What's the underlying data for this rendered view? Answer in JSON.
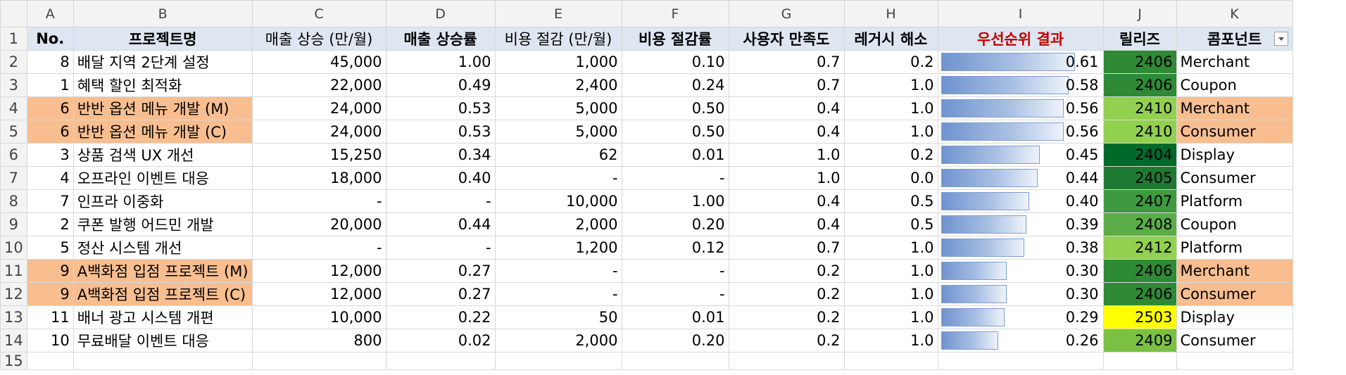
{
  "column_letters": [
    "A",
    "B",
    "C",
    "D",
    "E",
    "F",
    "G",
    "H",
    "I",
    "J",
    "K"
  ],
  "headers": [
    "No.",
    "프로젝트명",
    "매출 상승 (만/월)",
    "매출 상승률",
    "비용 절감 (만/월)",
    "비용 절감률",
    "사용자 만족도",
    "레거시 해소",
    "우선순위 결과",
    "릴리즈",
    "콤포넌트"
  ],
  "rows": [
    {
      "row": "2",
      "no": "8",
      "name": "배달 지역 2단계 설정",
      "rev": "45,000",
      "rev_rate": "1.00",
      "cost": "1,000",
      "cost_rate": "0.10",
      "sat": "0.7",
      "legacy": "0.2",
      "priority": "0.61",
      "priority_value": 0.61,
      "release": "2406",
      "release_color": "#2f8a35",
      "component": "Merchant",
      "highlight": false
    },
    {
      "row": "3",
      "no": "1",
      "name": "혜택 할인 최적화",
      "rev": "22,000",
      "rev_rate": "0.49",
      "cost": "2,400",
      "cost_rate": "0.24",
      "sat": "0.7",
      "legacy": "1.0",
      "priority": "0.58",
      "priority_value": 0.58,
      "release": "2406",
      "release_color": "#2f8a35",
      "component": "Coupon",
      "highlight": false
    },
    {
      "row": "4",
      "no": "6",
      "name": "반반 옵션 메뉴 개발 (M)",
      "rev": "24,000",
      "rev_rate": "0.53",
      "cost": "5,000",
      "cost_rate": "0.50",
      "sat": "0.4",
      "legacy": "1.0",
      "priority": "0.56",
      "priority_value": 0.56,
      "release": "2410",
      "release_color": "#92d050",
      "component": "Merchant",
      "highlight": true
    },
    {
      "row": "5",
      "no": "6",
      "name": "반반 옵션 메뉴 개발 (C)",
      "rev": "24,000",
      "rev_rate": "0.53",
      "cost": "5,000",
      "cost_rate": "0.50",
      "sat": "0.4",
      "legacy": "1.0",
      "priority": "0.56",
      "priority_value": 0.56,
      "release": "2410",
      "release_color": "#92d050",
      "component": "Consumer",
      "highlight": true
    },
    {
      "row": "6",
      "no": "3",
      "name": "상품 검색 UX 개선",
      "rev": "15,250",
      "rev_rate": "0.34",
      "cost": "62",
      "cost_rate": "0.01",
      "sat": "1.0",
      "legacy": "0.2",
      "priority": "0.45",
      "priority_value": 0.45,
      "release": "2404",
      "release_color": "#006a2a",
      "component": "Display",
      "highlight": false
    },
    {
      "row": "7",
      "no": "4",
      "name": "오프라인 이벤트 대응",
      "rev": "18,000",
      "rev_rate": "0.40",
      "cost": "-",
      "cost_rate": "-",
      "sat": "1.0",
      "legacy": "0.0",
      "priority": "0.44",
      "priority_value": 0.44,
      "release": "2405",
      "release_color": "#1e7a33",
      "component": "Consumer",
      "highlight": false
    },
    {
      "row": "8",
      "no": "7",
      "name": "인프라 이중화",
      "rev": "-",
      "rev_rate": "-",
      "cost": "10,000",
      "cost_rate": "1.00",
      "sat": "0.4",
      "legacy": "0.5",
      "priority": "0.40",
      "priority_value": 0.4,
      "release": "2407",
      "release_color": "#3d9a3f",
      "component": "Platform",
      "highlight": false
    },
    {
      "row": "9",
      "no": "2",
      "name": "쿠폰 발행 어드민 개발",
      "rev": "20,000",
      "rev_rate": "0.44",
      "cost": "2,000",
      "cost_rate": "0.20",
      "sat": "0.4",
      "legacy": "0.5",
      "priority": "0.39",
      "priority_value": 0.39,
      "release": "2408",
      "release_color": "#5aad47",
      "component": "Coupon",
      "highlight": false
    },
    {
      "row": "10",
      "no": "5",
      "name": "정산 시스템 개선",
      "rev": "-",
      "rev_rate": "-",
      "cost": "1,200",
      "cost_rate": "0.12",
      "sat": "0.7",
      "legacy": "1.0",
      "priority": "0.38",
      "priority_value": 0.38,
      "release": "2412",
      "release_color": "#92d050",
      "component": "Platform",
      "highlight": false
    },
    {
      "row": "11",
      "no": "9",
      "name": "A백화점 입점 프로젝트 (M)",
      "rev": "12,000",
      "rev_rate": "0.27",
      "cost": "-",
      "cost_rate": "-",
      "sat": "0.2",
      "legacy": "1.0",
      "priority": "0.30",
      "priority_value": 0.3,
      "release": "2406",
      "release_color": "#2f8a35",
      "component": "Merchant",
      "highlight": true
    },
    {
      "row": "12",
      "no": "9",
      "name": "A백화점 입점 프로젝트 (C)",
      "rev": "12,000",
      "rev_rate": "0.27",
      "cost": "-",
      "cost_rate": "-",
      "sat": "0.2",
      "legacy": "1.0",
      "priority": "0.30",
      "priority_value": 0.3,
      "release": "2406",
      "release_color": "#2f8a35",
      "component": "Consumer",
      "highlight": true
    },
    {
      "row": "13",
      "no": "11",
      "name": "배너 광고 시스템 개편",
      "rev": "10,000",
      "rev_rate": "0.22",
      "cost": "50",
      "cost_rate": "0.01",
      "sat": "0.2",
      "legacy": "1.0",
      "priority": "0.29",
      "priority_value": 0.29,
      "release": "2503",
      "release_color": "#ffff00",
      "component": "Display",
      "highlight": false
    },
    {
      "row": "14",
      "no": "10",
      "name": "무료배달 이벤트 대응",
      "rev": "800",
      "rev_rate": "0.02",
      "cost": "2,000",
      "cost_rate": "0.20",
      "sat": "0.2",
      "legacy": "1.0",
      "priority": "0.26",
      "priority_value": 0.26,
      "release": "2409",
      "release_color": "#7ac143",
      "component": "Consumer",
      "highlight": false
    }
  ],
  "header_row_num": "1",
  "trailing_row_num": "15",
  "colors": {
    "highlight": "#f8be8f",
    "header_fill": "#dde6f1",
    "priority_header": "#c00000"
  }
}
